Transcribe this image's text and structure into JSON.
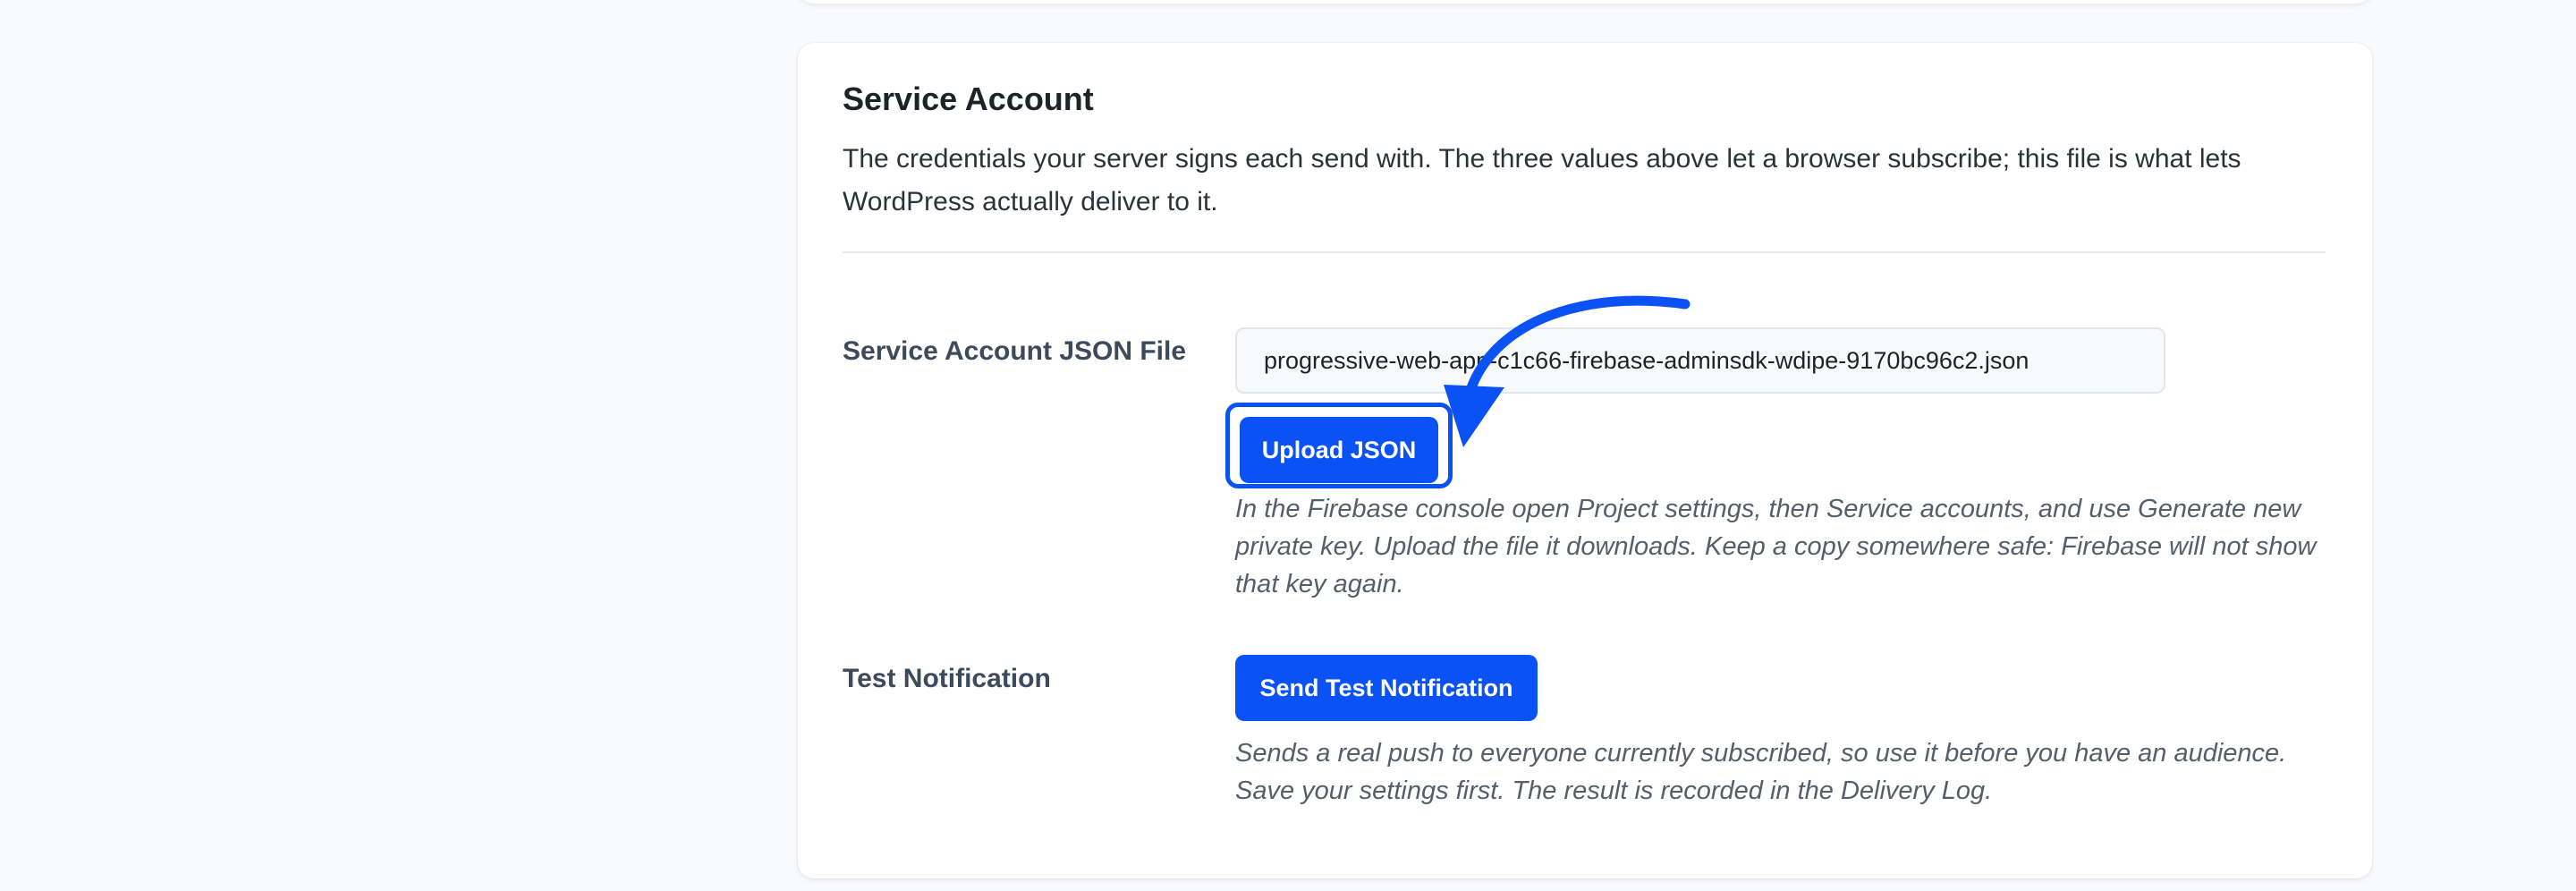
{
  "card": {
    "title": "Service Account",
    "description": "The credentials your server signs each send with. The three values above let a browser subscribe; this file is what lets WordPress actually deliver to it."
  },
  "json_file": {
    "label": "Service Account JSON File",
    "value": "progressive-web-app-c1c66-firebase-adminsdk-wdipe-9170bc96c2.json",
    "upload_label": "Upload JSON",
    "help": "In the Firebase console open Project settings, then Service accounts, and use Generate new private key. Upload the file it downloads. Keep a copy somewhere safe: Firebase will not show that key again."
  },
  "test_notification": {
    "label": "Test Notification",
    "button_label": "Send Test Notification",
    "help": "Sends a real push to everyone currently subscribed, so use it before you have an audience. Save your settings first. The result is recorded in the Delivery Log."
  },
  "colors": {
    "accent": "#0a52f5",
    "page_background": "#f9fafc",
    "card_background": "#ffffff"
  },
  "icons": {
    "annotation": "curved-arrow-icon"
  }
}
